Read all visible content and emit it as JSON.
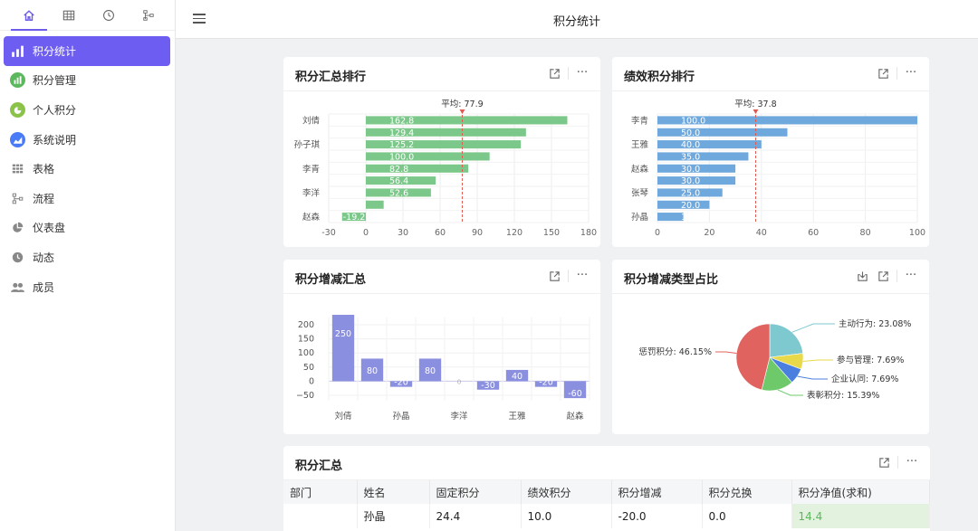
{
  "header": {
    "title": "积分统计"
  },
  "sidebar": {
    "tabs": [
      {
        "icon": "home-icon",
        "active": true
      },
      {
        "icon": "table-icon",
        "active": false
      },
      {
        "icon": "clock-icon",
        "active": false
      },
      {
        "icon": "flow-icon",
        "active": false
      }
    ],
    "items": [
      {
        "label": "积分统计",
        "icon": "bar-chart-icon",
        "active": true
      },
      {
        "label": "积分管理",
        "icon": "bar-chart-circle-icon",
        "color": "#5cb85c"
      },
      {
        "label": "个人积分",
        "icon": "pie-circle-icon",
        "color": "#8bc34a"
      },
      {
        "label": "系统说明",
        "icon": "area-chart-icon",
        "color": "#4a7bf7"
      },
      {
        "label": "表格",
        "icon": "grid-icon"
      },
      {
        "label": "流程",
        "icon": "flow-icon"
      },
      {
        "label": "仪表盘",
        "icon": "pie-icon"
      },
      {
        "label": "动态",
        "icon": "clock-icon"
      },
      {
        "label": "成员",
        "icon": "users-icon"
      }
    ]
  },
  "cards": {
    "ranking": {
      "title": "积分汇总排行",
      "avg_label": "平均: 77.9"
    },
    "perf": {
      "title": "绩效积分排行",
      "avg_label": "平均: 37.8"
    },
    "change": {
      "title": "积分增减汇总"
    },
    "type_share": {
      "title": "积分增减类型占比"
    },
    "summary": {
      "title": "积分汇总"
    }
  },
  "chart_data": [
    {
      "type": "bar",
      "orientation": "horizontal",
      "title": "积分汇总排行",
      "categories": [
        "刘倩",
        "",
        "孙子琪",
        "",
        "李青",
        "",
        "李洋",
        "",
        "赵森"
      ],
      "values": [
        162.8,
        129.4,
        125.2,
        100.0,
        82.8,
        56.4,
        52.6,
        14.4,
        -19.2
      ],
      "color": "#7cc88a",
      "average": 77.9,
      "xlim": [
        -30,
        180
      ],
      "xticks": [
        "-30",
        "0",
        "30",
        "60",
        "90",
        "120",
        "150",
        "180"
      ]
    },
    {
      "type": "bar",
      "orientation": "horizontal",
      "title": "绩效积分排行",
      "categories": [
        "李青",
        "",
        "王雅",
        "",
        "赵森",
        "",
        "张琴",
        "",
        "孙晶"
      ],
      "values": [
        100.0,
        50.0,
        40.0,
        35.0,
        30.0,
        30.0,
        25.0,
        20.0,
        10.0
      ],
      "color": "#6fa8dc",
      "average": 37.8,
      "xlim": [
        0,
        100
      ],
      "xticks": [
        "0",
        "20",
        "40",
        "60",
        "80",
        "100"
      ]
    },
    {
      "type": "bar",
      "title": "积分增减汇总",
      "categories": [
        "刘倩",
        "",
        "孙晶",
        "",
        "李洋",
        "",
        "王雅",
        "",
        "赵森"
      ],
      "values": [
        250,
        80,
        -20,
        80,
        0,
        -30,
        40,
        -20,
        -60
      ],
      "color": "#8b8fe0",
      "ylim": [
        -50,
        200
      ],
      "yticks": [
        "200",
        "150",
        "100",
        "50",
        "0",
        "−50"
      ]
    },
    {
      "type": "pie",
      "title": "积分增减类型占比",
      "slices": [
        {
          "label": "主动行为: 23.08%",
          "value": 23.08,
          "color": "#7ec8d0"
        },
        {
          "label": "参与管理: 7.69%",
          "value": 7.69,
          "color": "#e8d94a"
        },
        {
          "label": "企业认同: 7.69%",
          "value": 7.69,
          "color": "#4a7fe0"
        },
        {
          "label": "表彰积分: 15.39%",
          "value": 15.39,
          "color": "#6dc96a"
        },
        {
          "label": "惩罚积分: 46.15%",
          "value": 46.15,
          "color": "#e0635f"
        }
      ]
    }
  ],
  "table": {
    "headers": [
      "部门",
      "姓名",
      "固定积分",
      "绩效积分",
      "积分增减",
      "积分兑换",
      "积分净值(求和)"
    ],
    "rows": [
      [
        "",
        "孙晶",
        "24.4",
        "10.0",
        "-20.0",
        "0.0",
        "14.4"
      ]
    ]
  }
}
